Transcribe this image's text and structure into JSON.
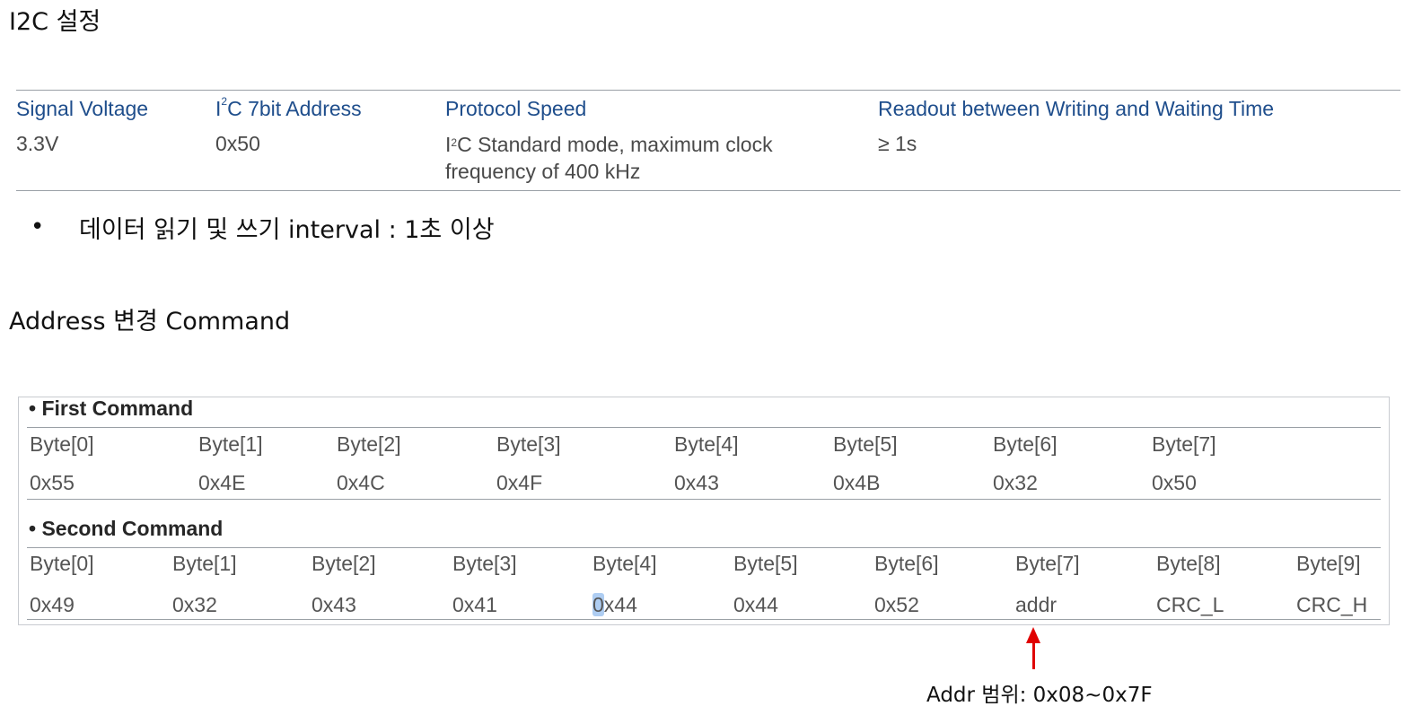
{
  "heading_i2c": "I2C 설정",
  "i2c_table": {
    "headers": {
      "signal_voltage": "Signal Voltage",
      "address_prefix": "I",
      "address_sup": "2",
      "address_rest": "C 7bit Address",
      "protocol_speed": "Protocol Speed",
      "readout": "Readout between Writing and Waiting Time"
    },
    "values": {
      "signal_voltage": "3.3V",
      "address": "0x50",
      "speed_prefix": "I",
      "speed_sup": "2",
      "speed_rest": "C Standard mode, maximum clock frequency of 400 kHz",
      "readout": "≥ 1s"
    }
  },
  "bullet": {
    "dot": "•",
    "text": "데이터 읽기 및 쓰기 interval : 1초 이상"
  },
  "heading_address": "Address 변경 Command",
  "first_command": {
    "title": "• First Command",
    "bytes": [
      "Byte[0]",
      "Byte[1]",
      "Byte[2]",
      "Byte[3]",
      "Byte[4]",
      "Byte[5]",
      "Byte[6]",
      "Byte[7]"
    ],
    "values": [
      "0x55",
      "0x4E",
      "0x4C",
      "0x4F",
      "0x43",
      "0x4B",
      "0x32",
      "0x50"
    ]
  },
  "second_command": {
    "title": "• Second Command",
    "bytes": [
      "Byte[0]",
      "Byte[1]",
      "Byte[2]",
      "Byte[3]",
      "Byte[4]",
      "Byte[5]",
      "Byte[6]",
      "Byte[7]",
      "Byte[8]",
      "Byte[9]"
    ],
    "values": [
      "0x49",
      "0x32",
      "0x43",
      "0x41",
      "0x44",
      "0x44",
      "0x52",
      "addr",
      "CRC_L",
      "CRC_H"
    ],
    "highlight_char": "0",
    "highlight_rest": "x44"
  },
  "addr_note": "Addr 범위: 0x08~0x7F",
  "colors": {
    "header_blue": "#1f4e8c",
    "arrow_red": "#e00000",
    "highlight": "#aecdf2"
  }
}
